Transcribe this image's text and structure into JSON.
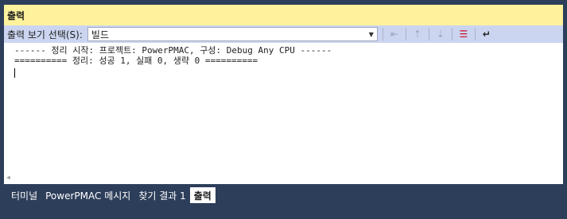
{
  "panel": {
    "title": "출력"
  },
  "toolbar": {
    "label": "출력 보기 선택(S):",
    "selected": "빌드",
    "buttons": [
      {
        "name": "find-message-icon",
        "glyph": "⇤"
      },
      {
        "name": "prev-message-icon",
        "glyph": "⇡"
      },
      {
        "name": "next-message-icon",
        "glyph": "⇣"
      },
      {
        "name": "clear-all-icon",
        "glyph": "☰"
      },
      {
        "name": "word-wrap-icon",
        "glyph": "↵"
      }
    ]
  },
  "output": {
    "lines": [
      "------ 정리 시작: 프로젝트: PowerPMAC, 구성: Debug Any CPU ------",
      "========== 정리: 성공 1, 실패 0, 생략 0 =========="
    ]
  },
  "tabs": [
    {
      "label": "터미널",
      "active": false
    },
    {
      "label": "PowerPMAC 메시지",
      "active": false
    },
    {
      "label": "찾기 결과 1",
      "active": false
    },
    {
      "label": "출력",
      "active": true
    }
  ]
}
